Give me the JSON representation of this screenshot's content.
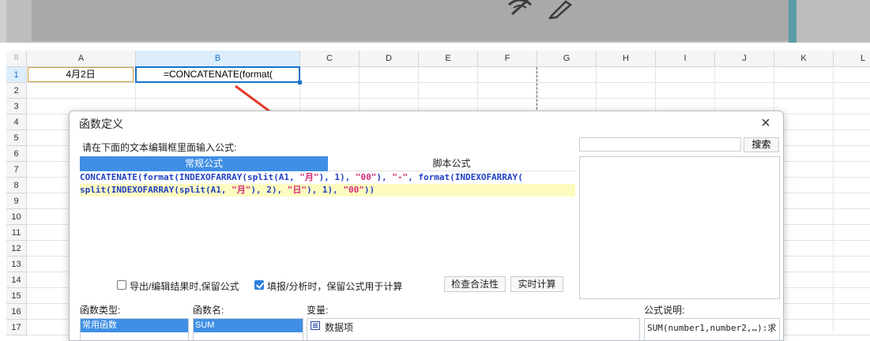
{
  "sheet": {
    "columns": [
      "A",
      "B",
      "C",
      "D",
      "E",
      "F",
      "G",
      "H",
      "I",
      "J",
      "K",
      "L"
    ],
    "rows": [
      "1",
      "2",
      "3",
      "4",
      "5",
      "6",
      "7",
      "8",
      "9",
      "10",
      "11",
      "12",
      "13",
      "14",
      "15",
      "16",
      "17"
    ],
    "cell_a1": "4月2日",
    "cell_b1": "=CONCATENATE(format("
  },
  "dialog": {
    "title": "函数定义",
    "close_icon": "×",
    "prompt": "请在下面的文本编辑框里面输入公式:",
    "tabs": {
      "normal": "常规公式",
      "script": "脚本公式"
    },
    "formula": {
      "line1": [
        {
          "t": "CONCATENATE",
          "c": "fn"
        },
        {
          "t": "(",
          "c": "pn"
        },
        {
          "t": "format",
          "c": "fn"
        },
        {
          "t": "(",
          "c": "pn"
        },
        {
          "t": "INDEXOFARRAY",
          "c": "fn"
        },
        {
          "t": "(",
          "c": "pn"
        },
        {
          "t": "split",
          "c": "fn"
        },
        {
          "t": "(A1, ",
          "c": "pn"
        },
        {
          "t": "\"月\"",
          "c": "str"
        },
        {
          "t": "), 1), ",
          "c": "pn"
        },
        {
          "t": "\"00\"",
          "c": "str"
        },
        {
          "t": "), ",
          "c": "pn"
        },
        {
          "t": "\"-\"",
          "c": "str"
        },
        {
          "t": ", ",
          "c": "pn"
        },
        {
          "t": "format",
          "c": "fn"
        },
        {
          "t": "(",
          "c": "pn"
        },
        {
          "t": "INDEXOFARRAY",
          "c": "fn"
        },
        {
          "t": "(",
          "c": "pn"
        }
      ],
      "line2": [
        {
          "t": "split",
          "c": "fn"
        },
        {
          "t": "(",
          "c": "pn"
        },
        {
          "t": "INDEXOFARRAY",
          "c": "fn"
        },
        {
          "t": "(",
          "c": "pn"
        },
        {
          "t": "split",
          "c": "fn"
        },
        {
          "t": "(A1, ",
          "c": "pn"
        },
        {
          "t": "\"月\"",
          "c": "str"
        },
        {
          "t": "), 2), ",
          "c": "pn"
        },
        {
          "t": "\"日\"",
          "c": "str"
        },
        {
          "t": "), 1), ",
          "c": "pn"
        },
        {
          "t": "\"00\"",
          "c": "str"
        },
        {
          "t": "))",
          "c": "pn"
        }
      ]
    },
    "search_placeholder": "",
    "search_button": "搜索",
    "options": {
      "export_keep": {
        "label": "导出/编辑结果时,保留公式",
        "checked": false
      },
      "fill_keep": {
        "label": "填报/分析时，保留公式用于计算",
        "checked": true
      }
    },
    "check_button": "检查合法性",
    "realtime_button": "实时计算",
    "labels": {
      "func_type": "函数类型:",
      "func_name": "函数名:",
      "variable": "变量:",
      "description": "公式说明:"
    },
    "func_type_selected": "常用函数",
    "func_name_selected": "SUM",
    "variable_item": "数据项",
    "description_text": "SUM(number1,number2,…):求"
  },
  "colors": {
    "accent": "#3f8fe5",
    "selection": "#1a73c8",
    "arrow": "#e8372c"
  }
}
